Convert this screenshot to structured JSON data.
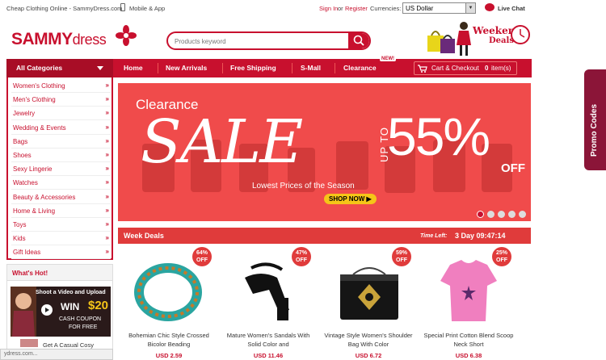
{
  "topbar": {
    "tagline": "Cheap Clothing Online - SammyDress.com",
    "mobile": "Mobile & App",
    "signin": "Sign In",
    "or": "or",
    "register": "Register",
    "currencies_label": "Currencies:",
    "currency_value": "US Dollar",
    "live_chat": "Live Chat"
  },
  "logo": {
    "sammy": "SAMMY",
    "dress": "dress"
  },
  "search": {
    "placeholder": "Products keyword"
  },
  "weekend": {
    "line1": "Weekend",
    "line2": "Deals"
  },
  "nav": {
    "all_categories": "All Categories",
    "items": [
      "Home",
      "New Arrivals",
      "Free Shipping",
      "S-Mall",
      "Clearance"
    ],
    "new_badge": "NEW!",
    "cart": "Cart & Checkout",
    "cart_count": "0",
    "cart_items": "item(s)"
  },
  "categories": [
    "Women's Clothing",
    "Men's Clothing",
    "Jewelry",
    "Wedding & Events",
    "Bags",
    "Shoes",
    "Sexy Lingerie",
    "Watches",
    "Beauty & Accessories",
    "Home & Living",
    "Toys",
    "Kids",
    "Gift Ideas"
  ],
  "category_arrow": "»",
  "banner": {
    "clearance": "Clearance",
    "sale": "SALE",
    "up_to": "UP TO",
    "percent": "55%",
    "off": "OFF",
    "subtitle": "Lowest Prices of the Season",
    "shop_now": "SHOP NOW ▶",
    "dots_active": 1,
    "dots_total": 5
  },
  "week_deals": {
    "title": "Week Deals",
    "time_left_label": "Time Left:",
    "time_left": "3 Day 09:47:14"
  },
  "products": [
    {
      "name": "Bohemian Chic Style Crossed Bicolor Beading",
      "price": "USD 2.59",
      "discount": "64%",
      "off": "OFF"
    },
    {
      "name": "Mature Women's Sandals With Solid Color and",
      "price": "USD 11.46",
      "discount": "47%",
      "off": "OFF"
    },
    {
      "name": "Vintage Style Women's Shoulder Bag With Color",
      "price": "USD 6.72",
      "discount": "59%",
      "off": "OFF"
    },
    {
      "name": "Special Print Cotton Blend Scoop Neck Short",
      "price": "USD 6.38",
      "discount": "25%",
      "off": "OFF"
    }
  ],
  "whats_hot": {
    "title": "What's Hot!",
    "promo_line1": "Shoot a Video and Upload",
    "win": "WIN",
    "amount": "$20",
    "coupon": "CASH COUPON",
    "free": "FOR FREE",
    "next": "Get A Casual Cosy"
  },
  "promo_codes": "Promo Codes",
  "status_bar": "ydress.com...",
  "colors": {
    "brand_red": "#c8102e",
    "banner_red": "#f04b4b",
    "promo_purple": "#8b1538"
  }
}
